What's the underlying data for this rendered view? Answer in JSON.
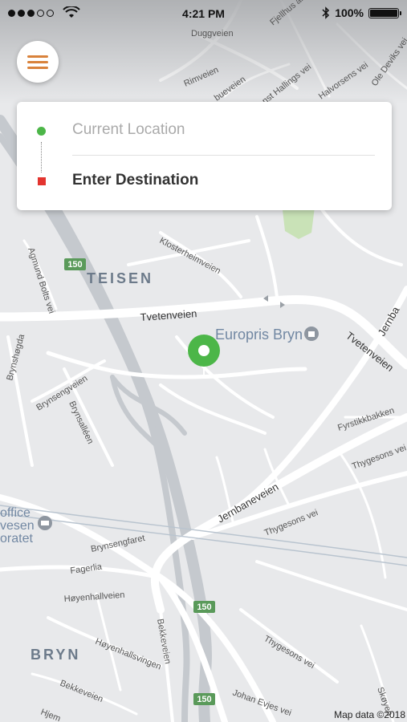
{
  "status_bar": {
    "time": "4:21 PM",
    "battery": "100%",
    "signal_dots_filled": 3,
    "signal_dots_total": 5,
    "icons": [
      "wifi-icon",
      "bluetooth-icon",
      "battery-icon"
    ]
  },
  "menu": {
    "icon": "hamburger-menu-icon",
    "accent_color": "#d9823b"
  },
  "route_card": {
    "origin_placeholder": "Current Location",
    "destination_placeholder": "Enter Destination",
    "origin_marker_color": "#4cb648",
    "destination_marker_color": "#e3342f"
  },
  "map": {
    "pin_color": "#4cb648",
    "attribution": "Map data ©2018",
    "area_labels": [
      "TEISEN",
      "BRYN"
    ],
    "poi": [
      "Europris Bryn",
      "office",
      "vesen",
      "oratet"
    ],
    "road_shields": [
      "150",
      "150",
      "150"
    ],
    "street_labels": [
      "Duggveien",
      "Rimveien",
      "Fjellhus al",
      "bueveien",
      "nst Hallings vei",
      "Halvorsens vei",
      "Ole Deviks vei",
      "Klosterheimveien",
      "Agmund Bolts vei",
      "Tvetenveien",
      "Tvetenveien",
      "Jernba",
      "Brynshøgda",
      "Brynsengveien",
      "Brynsalléen",
      "Fyrstikkbakken",
      "Jernbaneveien",
      "Thygesons vei",
      "Thygesons vei",
      "Brynsengfaret",
      "Fagerlia",
      "Høyenhallveien",
      "Høyenhallsvingen",
      "Bekkeveien",
      "Bekkeveien",
      "Johan Evjes vei",
      "Skøyen",
      "Hjem",
      "Thygesons vei"
    ]
  }
}
